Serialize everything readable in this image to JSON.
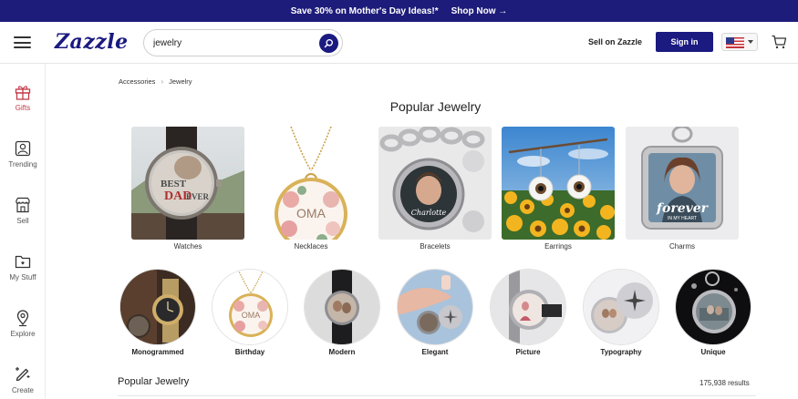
{
  "promo": {
    "text": "Save 30% on Mother's Day Ideas!*",
    "link": "Shop Now →"
  },
  "header": {
    "logo": "Zazzle",
    "search_value": "jewelry",
    "sell_label": "Sell on Zazzle",
    "signin_label": "Sign in",
    "locale_flag": "US",
    "icons": [
      "menu-icon",
      "search-icon",
      "flag-icon",
      "cart-icon"
    ]
  },
  "sidebar": {
    "items": [
      {
        "label": "Gifts",
        "icon": "gift-icon",
        "active": true
      },
      {
        "label": "Trending",
        "icon": "trending-icon",
        "active": false
      },
      {
        "label": "Sell",
        "icon": "store-icon",
        "active": false
      },
      {
        "label": "My Stuff",
        "icon": "folder-icon",
        "active": false
      },
      {
        "label": "Explore",
        "icon": "location-pin-icon",
        "active": false
      },
      {
        "label": "Create",
        "icon": "pencil-sparkle-icon",
        "active": false
      }
    ]
  },
  "breadcrumb": [
    "Accessories",
    "Jewelry"
  ],
  "page_title": "Popular Jewelry",
  "categories": [
    {
      "label": "Watches"
    },
    {
      "label": "Necklaces",
      "image_text": "OMA"
    },
    {
      "label": "Bracelets",
      "image_text": "Charlotte"
    },
    {
      "label": "Earrings"
    },
    {
      "label": "Charms",
      "image_text": "forever",
      "image_subtext": "IN MY HEART"
    }
  ],
  "styles": [
    {
      "label": "Monogrammed"
    },
    {
      "label": "Birthday",
      "image_text": "OMA"
    },
    {
      "label": "Modern"
    },
    {
      "label": "Elegant"
    },
    {
      "label": "Picture"
    },
    {
      "label": "Typography"
    },
    {
      "label": "Unique"
    }
  ],
  "watch_text": {
    "line1": "BEST",
    "line2": "DAD",
    "line3": "EVER"
  },
  "results_section": {
    "title": "Popular Jewelry",
    "count": "175,938 results"
  },
  "colors": {
    "brand": "#1a1a80",
    "promo_bg": "#1d1c7a",
    "active": "#c43a48"
  }
}
